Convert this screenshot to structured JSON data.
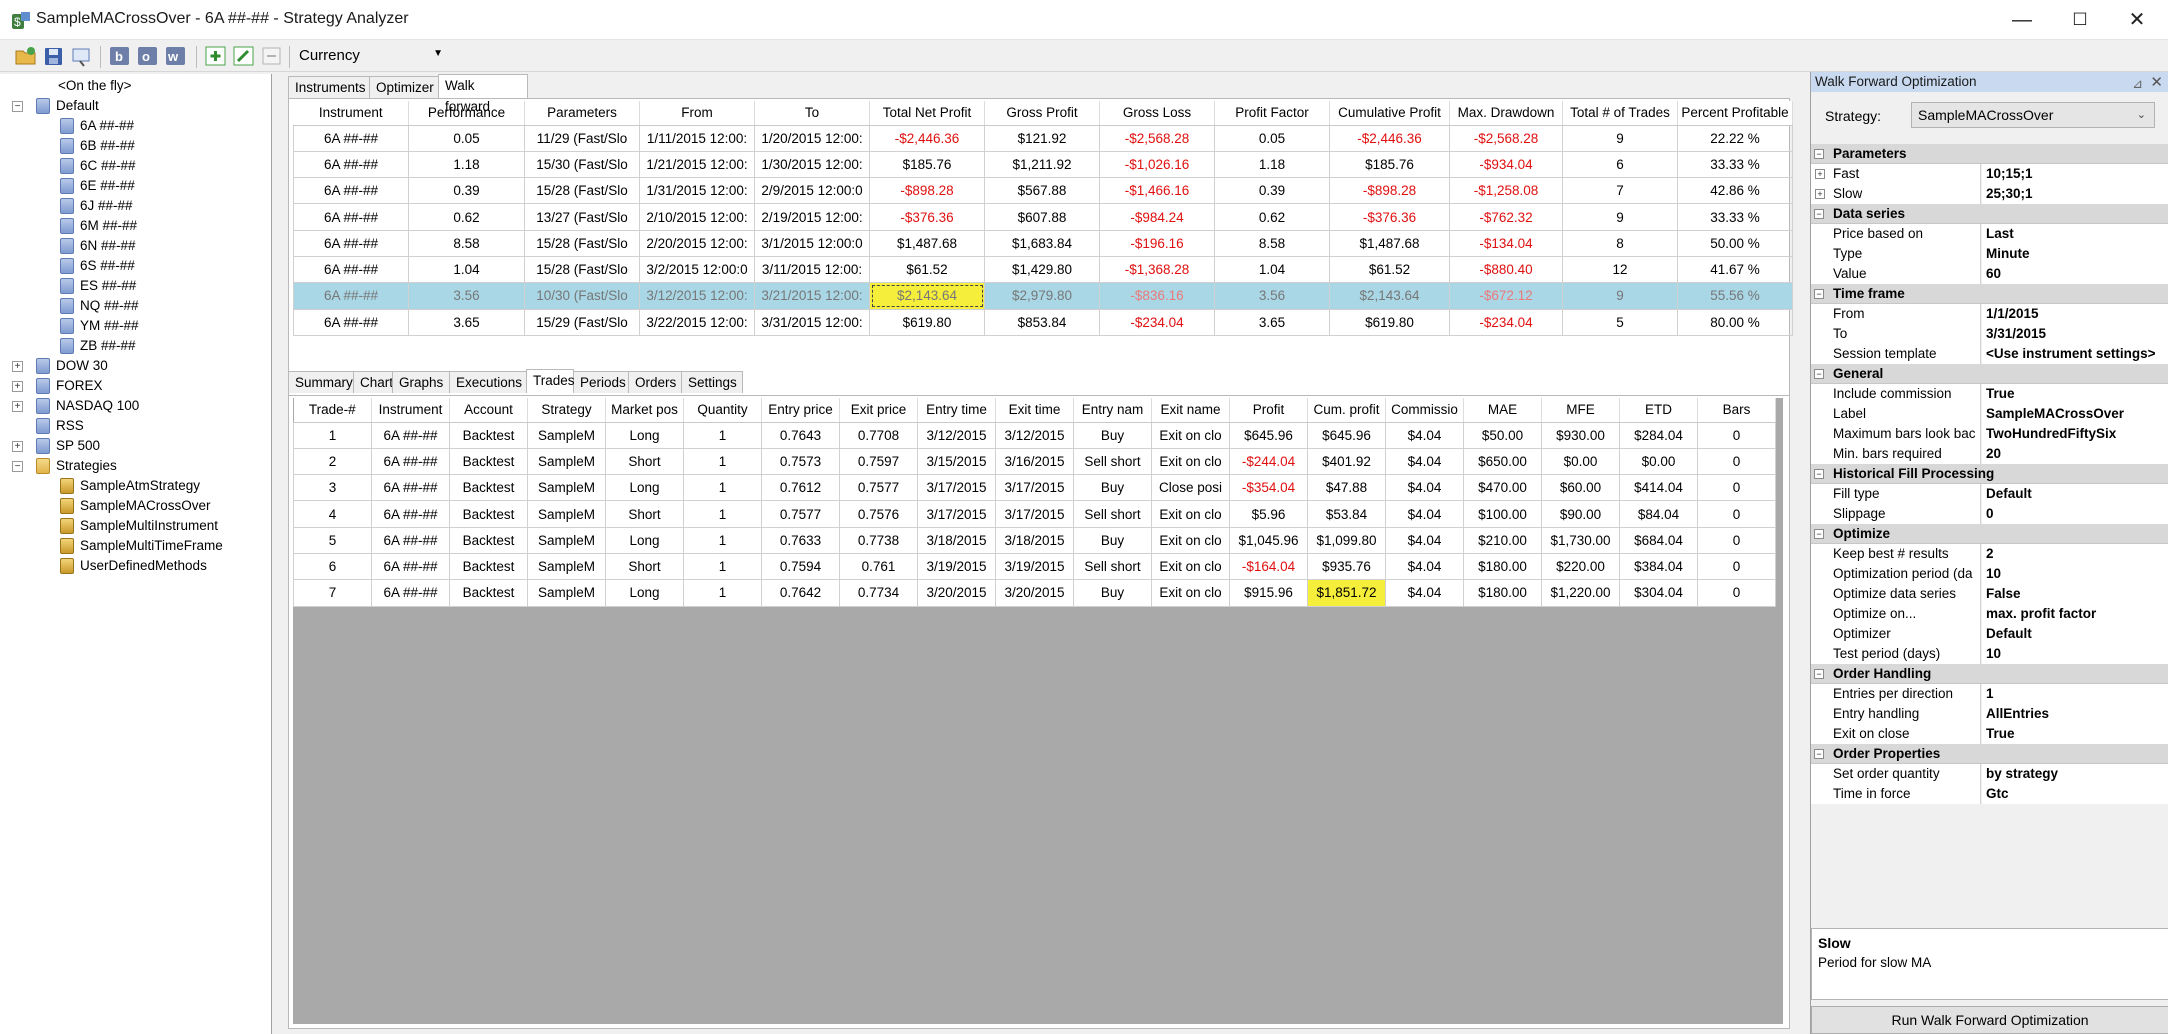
{
  "window": {
    "title": "SampleMACrossOver - 6A ##-## - Strategy Analyzer",
    "minimize": "—",
    "maximize": "☐",
    "close": "✕"
  },
  "toolbar": {
    "currency": "Currency"
  },
  "tree": {
    "on_the_fly": "<On the fly>",
    "default": "Default",
    "instruments": [
      "6A ##-##",
      "6B ##-##",
      "6C ##-##",
      "6E ##-##",
      "6J ##-##",
      "6M ##-##",
      "6N ##-##",
      "6S ##-##",
      "ES ##-##",
      "NQ ##-##",
      "YM ##-##",
      "ZB ##-##"
    ],
    "lists": [
      "DOW 30",
      "FOREX",
      "NASDAQ 100",
      "RSS",
      "SP 500"
    ],
    "strategies": "Strategies",
    "strategy_items": [
      "SampleAtmStrategy",
      "SampleMACrossOver",
      "SampleMultiInstrument",
      "SampleMultiTimeFrame",
      "UserDefinedMethods"
    ]
  },
  "top_tabs": [
    "Instruments",
    "Optimizer",
    "Walk forward"
  ],
  "walk_forward": {
    "columns": [
      "Instrument",
      "Performance",
      "Parameters",
      "From",
      "To",
      "Total Net Profit",
      "Gross Profit",
      "Gross Loss",
      "Profit Factor",
      "Cumulative Profit",
      "Max. Drawdown",
      "Total # of Trades",
      "Percent Profitable"
    ],
    "rows": [
      [
        "6A ##-##",
        "0.05",
        "11/29 (Fast/Slo",
        "1/11/2015 12:00:",
        "1/20/2015 12:00:",
        "-$2,446.36",
        "$121.92",
        "-$2,568.28",
        "0.05",
        "-$2,446.36",
        "-$2,568.28",
        "9",
        "22.22 %"
      ],
      [
        "6A ##-##",
        "1.18",
        "15/30 (Fast/Slo",
        "1/21/2015 12:00:",
        "1/30/2015 12:00:",
        "$185.76",
        "$1,211.92",
        "-$1,026.16",
        "1.18",
        "$185.76",
        "-$934.04",
        "6",
        "33.33 %"
      ],
      [
        "6A ##-##",
        "0.39",
        "15/28 (Fast/Slo",
        "1/31/2015 12:00:",
        "2/9/2015 12:00:0",
        "-$898.28",
        "$567.88",
        "-$1,466.16",
        "0.39",
        "-$898.28",
        "-$1,258.08",
        "7",
        "42.86 %"
      ],
      [
        "6A ##-##",
        "0.62",
        "13/27 (Fast/Slo",
        "2/10/2015 12:00:",
        "2/19/2015 12:00:",
        "-$376.36",
        "$607.88",
        "-$984.24",
        "0.62",
        "-$376.36",
        "-$762.32",
        "9",
        "33.33 %"
      ],
      [
        "6A ##-##",
        "8.58",
        "15/28 (Fast/Slo",
        "2/20/2015 12:00:",
        "3/1/2015 12:00:0",
        "$1,487.68",
        "$1,683.84",
        "-$196.16",
        "8.58",
        "$1,487.68",
        "-$134.04",
        "8",
        "50.00 %"
      ],
      [
        "6A ##-##",
        "1.04",
        "15/28 (Fast/Slo",
        "3/2/2015 12:00:0",
        "3/11/2015 12:00:",
        "$61.52",
        "$1,429.80",
        "-$1,368.28",
        "1.04",
        "$61.52",
        "-$880.40",
        "12",
        "41.67 %"
      ],
      [
        "6A ##-##",
        "3.56",
        "10/30 (Fast/Slo",
        "3/12/2015 12:00:",
        "3/21/2015 12:00:",
        "$2,143.64",
        "$2,979.80",
        "-$836.16",
        "3.56",
        "$2,143.64",
        "-$672.12",
        "9",
        "55.56 %"
      ],
      [
        "6A ##-##",
        "3.65",
        "15/29 (Fast/Slo",
        "3/22/2015 12:00:",
        "3/31/2015 12:00:",
        "$619.80",
        "$853.84",
        "-$234.04",
        "3.65",
        "$619.80",
        "-$234.04",
        "5",
        "80.00 %"
      ]
    ],
    "selected_row": 6,
    "negative_color": "#e01010",
    "highlight_color": "#f5ee3a",
    "selection_color": "#a9d7e6"
  },
  "bottom_tabs": [
    "Summary",
    "Chart",
    "Graphs",
    "Executions",
    "Trades",
    "Periods",
    "Orders",
    "Settings"
  ],
  "trades": {
    "columns": [
      "Trade-#",
      "Instrument",
      "Account",
      "Strategy",
      "Market pos",
      "Quantity",
      "Entry price",
      "Exit price",
      "Entry time",
      "Exit time",
      "Entry nam",
      "Exit name",
      "Profit",
      "Cum. profit",
      "Commissio",
      "MAE",
      "MFE",
      "ETD",
      "Bars"
    ],
    "rows": [
      [
        "1",
        "6A ##-##",
        "Backtest",
        "SampleM",
        "Long",
        "1",
        "0.7643",
        "0.7708",
        "3/12/2015",
        "3/12/2015",
        "Buy",
        "Exit on clo",
        "$645.96",
        "$645.96",
        "$4.04",
        "$50.00",
        "$930.00",
        "$284.04",
        "0"
      ],
      [
        "2",
        "6A ##-##",
        "Backtest",
        "SampleM",
        "Short",
        "1",
        "0.7573",
        "0.7597",
        "3/15/2015",
        "3/16/2015",
        "Sell short",
        "Exit on clo",
        "-$244.04",
        "$401.92",
        "$4.04",
        "$650.00",
        "$0.00",
        "$0.00",
        "0"
      ],
      [
        "3",
        "6A ##-##",
        "Backtest",
        "SampleM",
        "Long",
        "1",
        "0.7612",
        "0.7577",
        "3/17/2015",
        "3/17/2015",
        "Buy",
        "Close posi",
        "-$354.04",
        "$47.88",
        "$4.04",
        "$470.00",
        "$60.00",
        "$414.04",
        "0"
      ],
      [
        "4",
        "6A ##-##",
        "Backtest",
        "SampleM",
        "Short",
        "1",
        "0.7577",
        "0.7576",
        "3/17/2015",
        "3/17/2015",
        "Sell short",
        "Exit on clo",
        "$5.96",
        "$53.84",
        "$4.04",
        "$100.00",
        "$90.00",
        "$84.04",
        "0"
      ],
      [
        "5",
        "6A ##-##",
        "Backtest",
        "SampleM",
        "Long",
        "1",
        "0.7633",
        "0.7738",
        "3/18/2015",
        "3/18/2015",
        "Buy",
        "Exit on clo",
        "$1,045.96",
        "$1,099.80",
        "$4.04",
        "$210.00",
        "$1,730.00",
        "$684.04",
        "0"
      ],
      [
        "6",
        "6A ##-##",
        "Backtest",
        "SampleM",
        "Short",
        "1",
        "0.7594",
        "0.761",
        "3/19/2015",
        "3/19/2015",
        "Sell short",
        "Exit on clo",
        "-$164.04",
        "$935.76",
        "$4.04",
        "$180.00",
        "$220.00",
        "$384.04",
        "0"
      ],
      [
        "7",
        "6A ##-##",
        "Backtest",
        "SampleM",
        "Long",
        "1",
        "0.7642",
        "0.7734",
        "3/20/2015",
        "3/20/2015",
        "Buy",
        "Exit on clo",
        "$915.96",
        "$1,851.72",
        "$4.04",
        "$180.00",
        "$1,220.00",
        "$304.04",
        "0"
      ]
    ]
  },
  "properties": {
    "header": "Walk Forward Optimization",
    "strategy_label": "Strategy:",
    "strategy_value": "SampleMACrossOver",
    "sections": [
      {
        "title": "Parameters",
        "rows": [
          [
            "Fast",
            "10;15;1",
            true
          ],
          [
            "Slow",
            "25;30;1",
            true
          ]
        ]
      },
      {
        "title": "Data series",
        "rows": [
          [
            "Price based on",
            "Last",
            false
          ],
          [
            "Type",
            "Minute",
            false
          ],
          [
            "Value",
            "60",
            false
          ]
        ]
      },
      {
        "title": "Time frame",
        "rows": [
          [
            "From",
            "1/1/2015",
            false
          ],
          [
            "To",
            "3/31/2015",
            false
          ],
          [
            "Session template",
            "<Use instrument settings>",
            false
          ]
        ]
      },
      {
        "title": "General",
        "rows": [
          [
            "Include commission",
            "True",
            false
          ],
          [
            "Label",
            "SampleMACrossOver",
            false
          ],
          [
            "Maximum bars look bac",
            "TwoHundredFiftySix",
            false
          ],
          [
            "Min. bars required",
            "20",
            false
          ]
        ]
      },
      {
        "title": "Historical Fill Processing",
        "rows": [
          [
            "Fill type",
            "Default",
            false
          ],
          [
            "Slippage",
            "0",
            false
          ]
        ]
      },
      {
        "title": "Optimize",
        "rows": [
          [
            "Keep best # results",
            "2",
            false
          ],
          [
            "Optimization period (da",
            "10",
            false
          ],
          [
            "Optimize data series",
            "False",
            false
          ],
          [
            "Optimize on...",
            "max. profit factor",
            false
          ],
          [
            "Optimizer",
            "Default",
            false
          ],
          [
            "Test period (days)",
            "10",
            false
          ]
        ]
      },
      {
        "title": "Order Handling",
        "rows": [
          [
            "Entries per direction",
            "1",
            false
          ],
          [
            "Entry handling",
            "AllEntries",
            false
          ],
          [
            "Exit on close",
            "True",
            false
          ]
        ]
      },
      {
        "title": "Order Properties",
        "rows": [
          [
            "Set order quantity",
            "by strategy",
            false
          ],
          [
            "Time in force",
            "Gtc",
            false
          ]
        ]
      }
    ],
    "description_title": "Slow",
    "description_text": "Period for slow MA",
    "run_button": "Run Walk Forward Optimization"
  }
}
